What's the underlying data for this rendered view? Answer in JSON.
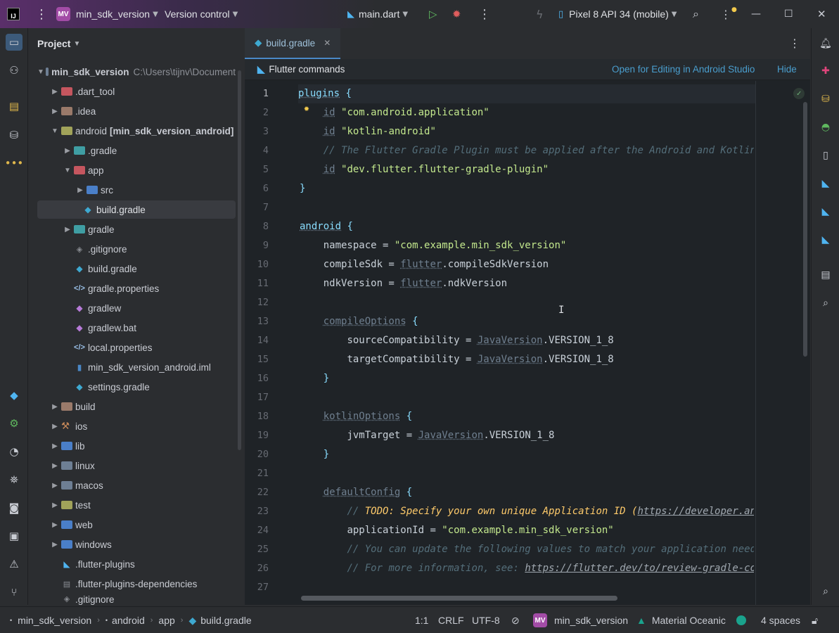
{
  "titlebar": {
    "logo": "IJ",
    "project_badge": "MV",
    "project_name": "min_sdk_version",
    "vcs": "Version control",
    "run_config": "main.dart",
    "device": "Pixel 8 API 34 (mobile)"
  },
  "project_panel": {
    "title": "Project",
    "root_name": "min_sdk_version",
    "root_path": "C:\\Users\\tijnv\\Document",
    "items": {
      "dart_tool": ".dart_tool",
      "idea": ".idea",
      "android": "android",
      "android_module": "[min_sdk_version_android]",
      "android_gradle": ".gradle",
      "app": "app",
      "src": "src",
      "app_build_gradle": "build.gradle",
      "gradle": "gradle",
      "gitignore": ".gitignore",
      "build_gradle": "build.gradle",
      "gradle_properties": "gradle.properties",
      "gradlew": "gradlew",
      "gradlew_bat": "gradlew.bat",
      "local_properties": "local.properties",
      "android_iml": "min_sdk_version_android.iml",
      "settings_gradle": "settings.gradle",
      "build": "build",
      "ios": "ios",
      "lib": "lib",
      "linux": "linux",
      "macos": "macos",
      "test": "test",
      "web": "web",
      "windows": "windows",
      "flutter_plugins": ".flutter-plugins",
      "flutter_plugins_dependencies": ".flutter-plugins-dependencies",
      "gitignore2": ".gitignore"
    }
  },
  "editor": {
    "tab_label": "build.gradle",
    "banner": {
      "title": "Flutter commands",
      "open_link": "Open for Editing in Android Studio",
      "hide_link": "Hide"
    },
    "line_numbers": [
      "1",
      "2",
      "3",
      "4",
      "5",
      "6",
      "7",
      "8",
      "9",
      "10",
      "11",
      "12",
      "13",
      "14",
      "15",
      "16",
      "17",
      "18",
      "19",
      "20",
      "21",
      "22",
      "23",
      "24",
      "25",
      "26",
      "27"
    ],
    "code": {
      "l1_plugins": "plugins",
      "l2_id": "id",
      "l2_str": "\"com.android.application\"",
      "l3_id": "id",
      "l3_str": "\"kotlin-android\"",
      "l4_comment": "// The Flutter Gradle Plugin must be applied after the Android and Kotlin Gr",
      "l5_id": "id",
      "l5_str": "\"dev.flutter.flutter-gradle-plugin\"",
      "l8_android": "android",
      "l9_key": "namespace = ",
      "l9_str": "\"com.example.min_sdk_version\"",
      "l10_key": "compileSdk = ",
      "l10_flutter": "flutter",
      "l10_rest": ".compileSdkVersion",
      "l11_key": "ndkVersion = ",
      "l11_flutter": "flutter",
      "l11_rest": ".ndkVersion",
      "l13_block": "compileOptions",
      "l14_key": "sourceCompatibility = ",
      "l14_jv": "JavaVersion",
      "l14_rest": ".VERSION_1_8",
      "l15_key": "targetCompatibility = ",
      "l15_jv": "JavaVersion",
      "l15_rest": ".VERSION_1_8",
      "l18_block": "kotlinOptions",
      "l19_key": "jvmTarget = ",
      "l19_jv": "JavaVersion",
      "l19_rest": ".VERSION_1_8",
      "l22_block": "defaultConfig",
      "l23_prefix": "// ",
      "l23_todo": "TODO: Specify your own unique Application ID (",
      "l23_url": "https://developer.androi",
      "l24_key": "applicationId = ",
      "l24_str": "\"com.example.min_sdk_version\"",
      "l25_comment": "// You can update the following values to match your application needs.",
      "l26_comment": "// For more information, see: ",
      "l26_url": "https://flutter.dev/to/review-gradle-config"
    }
  },
  "statusbar": {
    "crumb_project": "min_sdk_version",
    "crumb_android": "android",
    "crumb_app": "app",
    "crumb_file": "build.gradle",
    "position": "1:1",
    "line_sep": "CRLF",
    "encoding": "UTF-8",
    "project_badge": "MV",
    "project": "min_sdk_version",
    "theme": "Material Oceanic",
    "indent": "4 spaces"
  },
  "colors": {
    "accent": "#4a88c7",
    "project_badge": "#a24ca6",
    "string": "#c3e88d",
    "keyword": "#89ddff",
    "todo": "#ffcb6b"
  }
}
